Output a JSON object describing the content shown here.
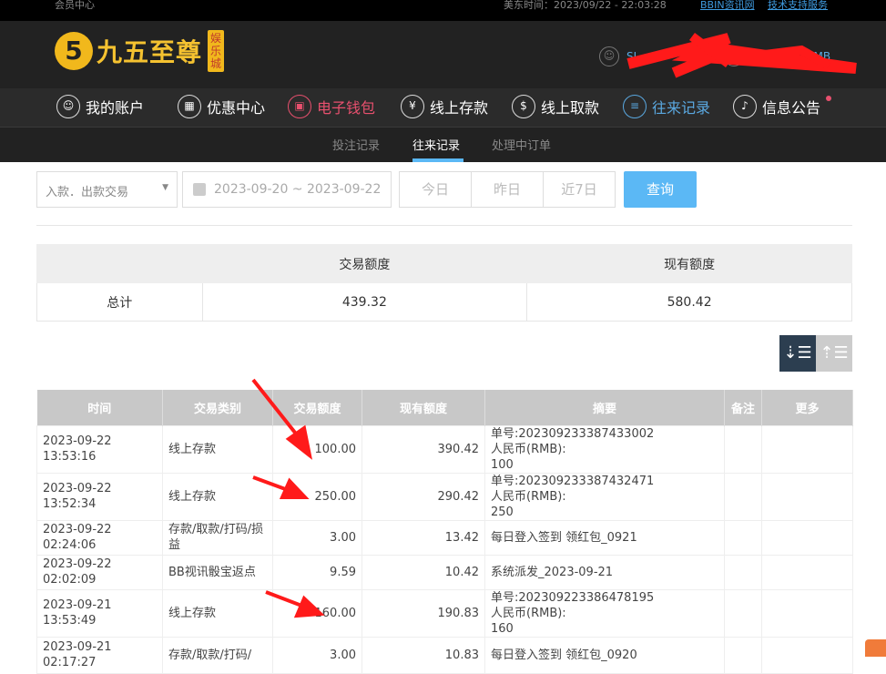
{
  "topbar": {
    "title": "会员中心",
    "time": "美东时间：2023/09/22 - 22:03:28",
    "links": [
      "BBIN资讯网",
      "技术支持服务"
    ]
  },
  "logo": {
    "text": "九五至尊",
    "badge": "娱乐城",
    "mark": "5"
  },
  "user": {
    "name": "SI",
    "balance": "RMB"
  },
  "nav": [
    {
      "label": "我的账户",
      "color": "#ffffff"
    },
    {
      "label": "优惠中心",
      "color": "#ffffff"
    },
    {
      "label": "电子钱包",
      "color": "#e8506e"
    },
    {
      "label": "线上存款",
      "color": "#ffffff"
    },
    {
      "label": "线上取款",
      "color": "#ffffff"
    },
    {
      "label": "往来记录",
      "color": "#5aa8e0"
    },
    {
      "label": "信息公告",
      "color": "#ffffff"
    }
  ],
  "subnav": [
    "投注记录",
    "往来记录",
    "处理中订单"
  ],
  "filter": {
    "type": "入款．出款交易",
    "date_range": "2023-09-20 ~ 2023-09-22",
    "quick": [
      "今日",
      "昨日",
      "近7日"
    ],
    "query": "查询"
  },
  "summary": {
    "headers": [
      "",
      "交易额度",
      "现有额度"
    ],
    "row": [
      "总计",
      "439.32",
      "580.42"
    ]
  },
  "table": {
    "headers": [
      "时间",
      "交易类别",
      "交易额度",
      "现有额度",
      "摘要",
      "备注",
      "更多"
    ],
    "rows": [
      [
        "2023-09-22 13:53:16",
        "线上存款",
        "100.00",
        "390.42",
        "单号:202309233387433002\n人民币(RMB):\n100",
        "",
        ""
      ],
      [
        "2023-09-22 13:52:34",
        "线上存款",
        "250.00",
        "290.42",
        "单号:202309233387432471\n人民币(RMB):\n250",
        "",
        ""
      ],
      [
        "2023-09-22 02:24:06",
        "存款/取款/打码/损益",
        "3.00",
        "13.42",
        "每日登入签到 领红包_0921",
        "",
        ""
      ],
      [
        "2023-09-22 02:02:09",
        "BB视讯骰宝返点",
        "9.59",
        "10.42",
        "系统派发_2023-09-21",
        "",
        ""
      ],
      [
        "2023-09-21 13:53:49",
        "线上存款",
        "160.00",
        "190.83",
        "单号:202309223386478195\n人民币(RMB):\n160",
        "",
        ""
      ],
      [
        "2023-09-21 02:17:27",
        "存款/取款/打码/",
        "3.00",
        "10.83",
        "每日登入签到 领红包_0920",
        "",
        ""
      ]
    ]
  }
}
